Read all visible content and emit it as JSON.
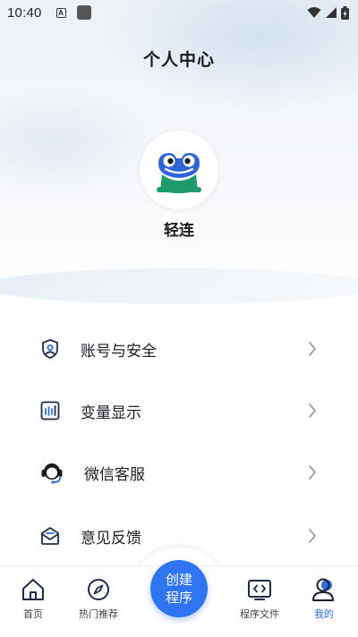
{
  "status_bar": {
    "time": "10:40",
    "a_icon_letter": "A"
  },
  "header": {
    "title": "个人中心"
  },
  "profile": {
    "name": "轻连"
  },
  "menu": [
    {
      "label": "账号与安全",
      "icon": "user-shield-icon"
    },
    {
      "label": "变量显示",
      "icon": "variable-bars-icon"
    },
    {
      "label": "微信客服",
      "icon": "headset-icon"
    },
    {
      "label": "意见反馈",
      "icon": "mail-feedback-icon"
    }
  ],
  "tabs": [
    {
      "label": "首页",
      "icon": "home-icon",
      "active": false
    },
    {
      "label": "热门推荐",
      "icon": "compass-icon",
      "active": false
    },
    {
      "label": "程序文件",
      "icon": "code-file-icon",
      "active": false
    },
    {
      "label": "我的",
      "icon": "profile-icon",
      "active": true
    }
  ],
  "create_button": {
    "label": "创建程序"
  },
  "colors": {
    "accent": "#2f74f0",
    "active_tab": "#2f6fe4",
    "frog_green": "#1e9a6b",
    "frog_blue": "#2f63d8"
  }
}
